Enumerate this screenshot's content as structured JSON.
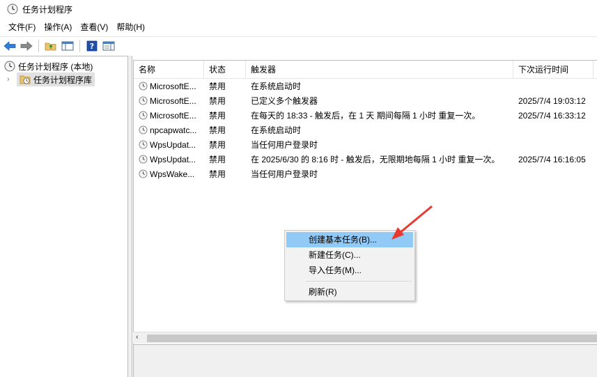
{
  "window": {
    "title": "任务计划程序",
    "icon": "clock-icon"
  },
  "menu": [
    "文件(F)",
    "操作(A)",
    "查看(V)",
    "帮助(H)"
  ],
  "toolbar": {
    "buttons": [
      "back-arrow-icon",
      "forward-arrow-icon",
      "folder-up-icon",
      "show-hide-console-tree-icon",
      "help-icon",
      "action-pane-icon"
    ]
  },
  "tree": {
    "root": "任务计划程序 (本地)",
    "child": "任务计划程序库"
  },
  "table": {
    "headers": {
      "name": "名称",
      "status": "状态",
      "trigger": "触发器",
      "next_run": "下次运行时间"
    },
    "rows": [
      {
        "name": "MicrosoftE...",
        "status": "禁用",
        "trigger": "在系统启动时",
        "next_run": ""
      },
      {
        "name": "MicrosoftE...",
        "status": "禁用",
        "trigger": "已定义多个触发器",
        "next_run": "2025/7/4 19:03:12"
      },
      {
        "name": "MicrosoftE...",
        "status": "禁用",
        "trigger": "在每天的 18:33 - 触发后，在 1 天 期间每隔 1 小时 重复一次。",
        "next_run": "2025/7/4 16:33:12"
      },
      {
        "name": "npcapwatc...",
        "status": "禁用",
        "trigger": "在系统启动时",
        "next_run": ""
      },
      {
        "name": "WpsUpdat...",
        "status": "禁用",
        "trigger": "当任何用户登录时",
        "next_run": ""
      },
      {
        "name": "WpsUpdat...",
        "status": "禁用",
        "trigger": "在 2025/6/30 的 8:16 时 - 触发后，无限期地每隔 1 小时 重复一次。",
        "next_run": "2025/7/4 16:16:05"
      },
      {
        "name": "WpsWake...",
        "status": "禁用",
        "trigger": "当任何用户登录时",
        "next_run": ""
      }
    ]
  },
  "context_menu": {
    "items": [
      "创建基本任务(B)...",
      "新建任务(C)...",
      "导入任务(M)...",
      "刷新(R)"
    ],
    "highlighted": 0
  },
  "colors": {
    "menu_highlight": "#91c9f7",
    "annotation_arrow": "#e8392f"
  }
}
